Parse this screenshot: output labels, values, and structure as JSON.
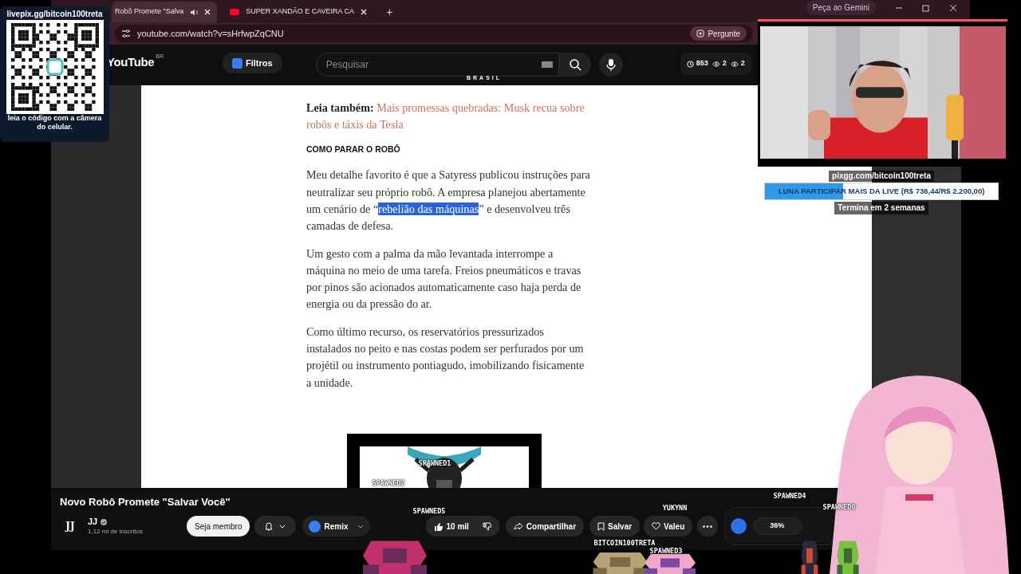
{
  "qr_overlay": {
    "caption_top": "livepix.gg/bitcoin100treta",
    "caption_bottom": "leia o código com a câmera do celular."
  },
  "browser": {
    "tabs": [
      {
        "title": "Robô Promete \"Salva",
        "selected": true,
        "audio": true
      },
      {
        "title": "SUPER XANDÃO E CAVEIRA CA",
        "selected": false,
        "audio": false
      }
    ],
    "new_tab_button": "+",
    "gemini_button": "Peça ao Gemini",
    "url": "youtube.com/watch?v=sHrfwpZqCNU",
    "ask_button": "Pergunte"
  },
  "youtube_header": {
    "logo": "YouTube",
    "region": "BR",
    "filter_button": "Filtros",
    "search_placeholder": "Pesquisar",
    "stats": [
      "853",
      "2",
      "2"
    ]
  },
  "article": {
    "masthead": "BRASIL",
    "blocks": [
      {
        "kind": "see_also",
        "lead": "Leia também:",
        "link": "Mais promessas quebradas: Musk recua sobre robôs e táxis da Tesla"
      },
      {
        "kind": "heading",
        "text": "COMO PARAR O ROBÔ"
      },
      {
        "kind": "paragraph",
        "parts": [
          {
            "text": "Meu detalhe favorito é que a Satyress publicou instruções para neutralizar seu próprio robô. A empresa planejou abertamente um cenário de “",
            "selected": false
          },
          {
            "text": "rebelião das máquinas",
            "selected": true
          },
          {
            "text": "” e desenvolveu três camadas de defesa.",
            "selected": false
          }
        ]
      },
      {
        "kind": "paragraph",
        "parts": [
          {
            "text": "Um gesto com a palma da mão levantada interrompe a máquina no meio de uma tarefa. Freios pneumáticos e travas por pinos são acionados automaticamente caso haja perda de energia ou da pressão do ar.",
            "selected": false
          }
        ]
      },
      {
        "kind": "paragraph",
        "parts": [
          {
            "text": "Como último recurso, os reservatórios pressurizados instalados no peito e nas costas podem ser perfurados por um projétil ou instrumento pontiagudo, imobilizando fisicamente a unidade.",
            "selected": false
          }
        ]
      },
      {
        "kind": "picture"
      }
    ]
  },
  "video": {
    "title": "Novo Robô Promete \"Salvar Você\"",
    "channel_logo": "JJ",
    "channel": "JJ",
    "verified": true,
    "subscribers": "1,12 mi de inscritos",
    "join_button": "Seja membro",
    "remix_button": "Remix",
    "likes": "10 mil",
    "share_button": "Compartilhar",
    "save_button": "Salvar",
    "thanks_button": "Valeu",
    "widget_percent": "36%"
  },
  "goal": {
    "url": "pixgg.com/bitcoin100treta",
    "label": "LUNA PARTICIPAR MAIS DA LIVE (R$ 736,44/R$ 2.200,00)",
    "level": 0.335,
    "ends": "Termina em 2 semanas"
  },
  "sprite_labels": [
    "SPAWNED1",
    "SPAWNED2",
    "SPAWNED5",
    "YUKYNN",
    "BITCOIN100TRETA",
    "SPAWNED3",
    "SPAWNED4",
    "SPAWNED0"
  ]
}
